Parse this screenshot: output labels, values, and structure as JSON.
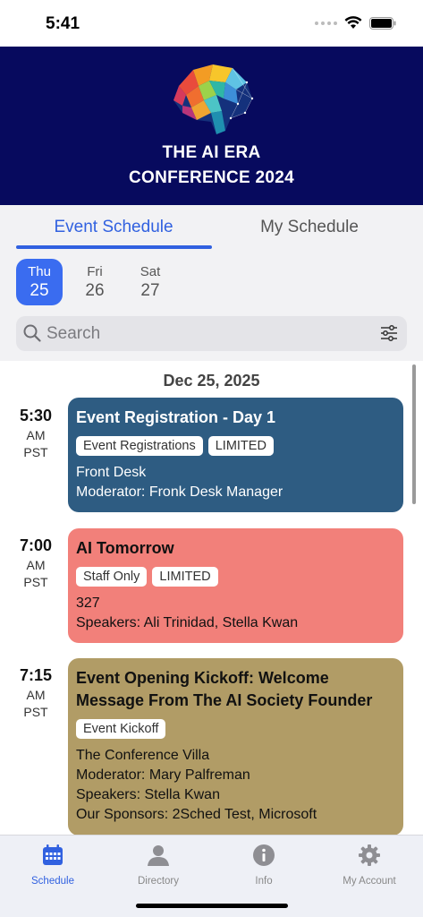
{
  "status": {
    "time": "5:41"
  },
  "banner": {
    "title_line1": "THE AI ERA",
    "title_line2": "CONFERENCE 2024"
  },
  "tabs": {
    "event_schedule": "Event Schedule",
    "my_schedule": "My Schedule",
    "active": "Event Schedule"
  },
  "days": [
    {
      "dow": "Thu",
      "num": "25",
      "selected": true
    },
    {
      "dow": "Fri",
      "num": "26",
      "selected": false
    },
    {
      "dow": "Sat",
      "num": "27",
      "selected": false
    }
  ],
  "search": {
    "placeholder": "Search",
    "value": ""
  },
  "schedule": {
    "date": "Dec 25, 2025",
    "events": [
      {
        "time": "5:30",
        "ampm": "AM",
        "tz": "PST",
        "title": "Event Registration - Day 1",
        "tags": [
          "Event Registrations",
          "LIMITED"
        ],
        "lines": [
          "Front Desk",
          "Moderator: Fronk Desk Manager"
        ],
        "color": "#2e5c82"
      },
      {
        "time": "7:00",
        "ampm": "AM",
        "tz": "PST",
        "title": "AI Tomorrow",
        "tags": [
          "Staff Only",
          "LIMITED"
        ],
        "lines": [
          "327",
          "Speakers: Ali Trinidad, Stella Kwan"
        ],
        "color": "#f2807a"
      },
      {
        "time": "7:15",
        "ampm": "AM",
        "tz": "PST",
        "title_line1": "Event Opening Kickoff: Welcome",
        "title_line2": "Message From The AI Society Founder",
        "tags": [
          "Event Kickoff"
        ],
        "lines": [
          "The Conference Villa",
          "Moderator: Mary Palfreman",
          "Speakers: Stella Kwan",
          "Our Sponsors: 2Sched Test, Microsoft"
        ],
        "color": "#b19c66"
      }
    ]
  },
  "tabbar": {
    "items": [
      {
        "label": "Schedule",
        "icon": "calendar-icon",
        "active": true
      },
      {
        "label": "Directory",
        "icon": "person-icon",
        "active": false
      },
      {
        "label": "Info",
        "icon": "info-icon",
        "active": false
      },
      {
        "label": "My Account",
        "icon": "gear-icon",
        "active": false
      }
    ]
  },
  "colors": {
    "accent": "#3161e0",
    "banner_bg": "#070a5e"
  }
}
